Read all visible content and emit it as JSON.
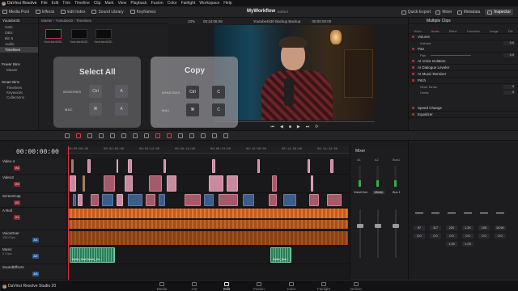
{
  "menubar": {
    "app_name": "DaVinci Resolve",
    "items": [
      "File",
      "Edit",
      "Trim",
      "Timeline",
      "Clip",
      "Mark",
      "View",
      "Playback",
      "Fusion",
      "Color",
      "Fairlight",
      "Workspace",
      "Help"
    ]
  },
  "toolbar": {
    "media_pool": "Media Pool",
    "effects": "Effects",
    "edit_index": "Edit Index",
    "sound_library": "Sound Library",
    "keyframes": "Keyframes",
    "project_title": "MyWorkflow",
    "project_status": "Edited",
    "quick_export": "Quick Export",
    "mixer": "Mixer",
    "metadata": "Metadata",
    "inspector": "Inspector"
  },
  "left_panel": {
    "header": "Youtube30",
    "items": [
      "Cam",
      "OBS",
      "Bin 5",
      "Audio",
      "Timelines"
    ],
    "selected_index": 4,
    "power_bins": "Power Bins",
    "master": "Master",
    "smart_bins": "Smart Bins",
    "smart_items": [
      "Timelines",
      "Keywords",
      "Collections"
    ]
  },
  "bin": {
    "path": "Master › Youtube30 › Timelines",
    "thumbs": [
      "Youtube4k30...",
      "Youtube4k30...",
      "Youtube4k30..."
    ]
  },
  "overlay_select_all": {
    "title": "Select All",
    "windows_label": "WINDOWS",
    "mac_label": "MAC",
    "win_keys": [
      "Ctrl",
      "A"
    ],
    "mac_keys": [
      "⌘",
      "A"
    ]
  },
  "overlay_copy": {
    "title": "Copy",
    "windows_label": "WINDOWS",
    "mac_label": "MAC",
    "win_keys": [
      "Ctrl",
      "C"
    ],
    "mac_keys": [
      "⌘",
      "C"
    ]
  },
  "viewer": {
    "zoom": "33%",
    "timecode_left": "00:24:06:06",
    "timeline_name": "Youtube4k30 Backup Backup",
    "timecode_right": "00:00:00:00"
  },
  "inspector": {
    "title": "Multiple Clips",
    "tabs": [
      "Video",
      "Audio",
      "Effect",
      "Transition",
      "Image",
      "File"
    ],
    "active_tab": "Audio",
    "volume": "Volume",
    "volume_sub": "Volume",
    "volume_val": "0.0",
    "pan": "Pan",
    "pan_sub": "Pan",
    "pan_val": "0.0",
    "ai_voice": "AI Voice Isolation",
    "ai_dialogue": "AI Dialogue Leveler",
    "ai_music": "AI Music Remixer",
    "pitch": "Pitch",
    "semi_tones": "Semi Tones",
    "semi_val": "0",
    "cents": "Cents",
    "cents_val": "0",
    "speed_change": "Speed Change",
    "equalizer": "Equalizer"
  },
  "timeline": {
    "timecode": "00:00:00:00",
    "ruler": [
      "00:00:00:00",
      "00:02:06:00",
      "00:04:12:00",
      "00:06:18:00",
      "00:08:24:00",
      "00:10:30:00",
      "00:12:36:00",
      "00:14:42:00"
    ],
    "tracks": [
      {
        "name": "Video 4",
        "sub": "",
        "badge": "V4",
        "type": "v"
      },
      {
        "name": "Video3",
        "sub": "",
        "badge": "V3",
        "type": "v"
      },
      {
        "name": "ScreenCap",
        "sub": "",
        "badge": "V2",
        "type": "v"
      },
      {
        "name": "A Roll",
        "sub": "",
        "badge": "V1",
        "type": "v"
      },
      {
        "name": "VoiceOver",
        "sub": "105 Clips",
        "badge": "A1",
        "type": "a"
      },
      {
        "name": "Music",
        "sub": "4 Clips",
        "badge": "A2",
        "type": "a"
      },
      {
        "name": "SoundEffects",
        "sub": "",
        "badge": "A3",
        "type": "a"
      }
    ],
    "clip_labels": [
      "Audio_Mac Harris_Sn...",
      "Audio_Nos..."
    ]
  },
  "mixer": {
    "title": "Mixer",
    "columns": [
      "A1",
      "A2",
      "Bus1"
    ],
    "buses": [
      "VoiceOver",
      "Music",
      "Bus 1"
    ],
    "selected_bus": "Music"
  },
  "eq": {
    "values": [
      "97",
      "117",
      "220",
      "1.2K",
      "10K",
      "19.0K",
      "0.0",
      "0.0",
      "0.0",
      "0.0",
      "0.0",
      "0.0",
      "1.00",
      "1.00"
    ]
  },
  "pagebar": {
    "studio": "DaVinci Resolve Studio 20",
    "pages": [
      "Media",
      "Cut",
      "Edit",
      "Fusion",
      "Color",
      "Fairlight",
      "Deliver"
    ],
    "active": "Edit"
  },
  "colors": {
    "video_clip": "#c98aa0",
    "audio_clip": "#c85a1c",
    "music_clip": "#2e7a5a",
    "playhead": "#e03040"
  }
}
